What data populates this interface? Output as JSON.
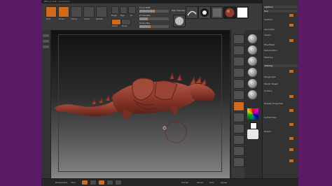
{
  "window": {
    "title": "ZBrush 4R6 · Document"
  },
  "shelf": {
    "tools": [
      {
        "name": "edit",
        "label": "Edit",
        "active": true
      },
      {
        "name": "draw",
        "label": "Draw",
        "active": true
      },
      {
        "name": "move",
        "label": "Move"
      },
      {
        "name": "scale",
        "label": "Scale"
      },
      {
        "name": "rotate",
        "label": "Rotate"
      }
    ],
    "mode_labels": [
      "Mrgb",
      "Rgb",
      "M"
    ],
    "zadd_label": "Zadd",
    "zsub_label": "Zsub",
    "focal_label": "Focal Shift",
    "draw_size_label": "Draw Size",
    "z_intensity_label": "Z Intensity",
    "rgb_intensity_label": "Rgb Intensity"
  },
  "palette_thumbs": [
    "brush-standard-icon",
    "stroke-icon",
    "alpha-icon",
    "texture-icon",
    "material-icon"
  ],
  "right_panel": {
    "rows": [
      "Lightbox",
      "Tool",
      "SubTool",
      "Geometry",
      "Layers",
      "FiberMesh",
      "Deformation",
      "Masking",
      "Visibility",
      "Polygroups",
      "Morph Target",
      "Surface",
      "Display Properties",
      "Unified Skin",
      "Export"
    ]
  },
  "bottom": {
    "labels": [
      "Perspective",
      "Floor",
      "Local",
      "Frame",
      "Move",
      "Scale",
      "Rotate",
      "Transp",
      "Ghost",
      "Solo",
      "Xpose"
    ]
  },
  "colors": {
    "accent": "#d06a1c",
    "model": "#8f3a2c",
    "background": "#5b1a66"
  }
}
